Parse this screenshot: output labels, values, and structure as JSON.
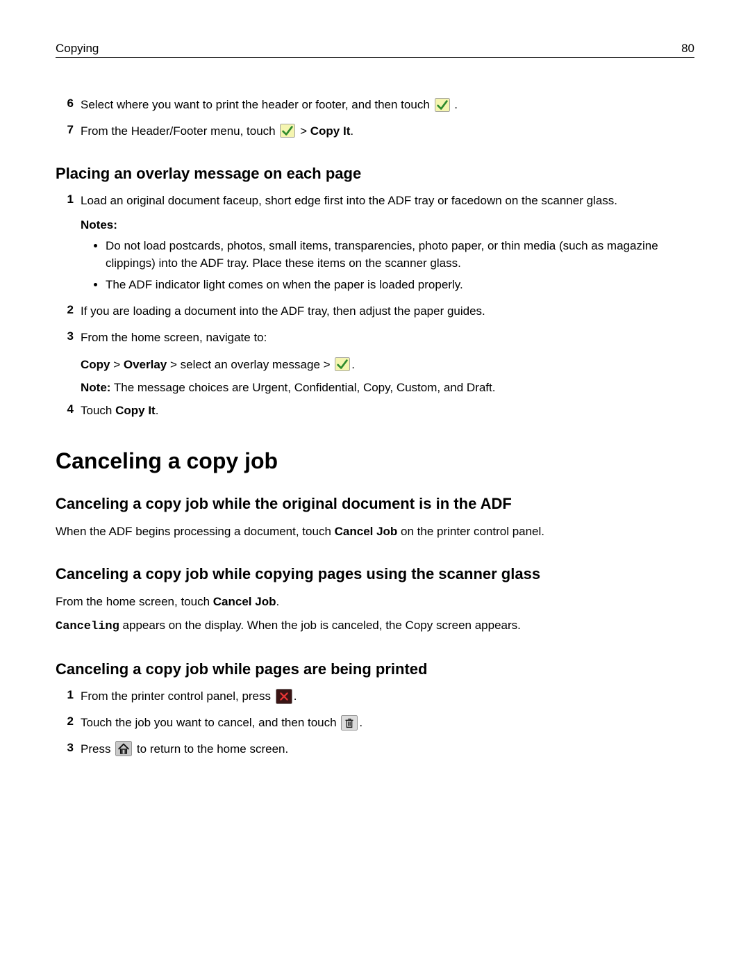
{
  "header": {
    "section": "Copying",
    "page_number": "80"
  },
  "top_steps": {
    "s6": {
      "num": "6",
      "a": "Select where you want to print the header or footer, and then touch ",
      "b": "."
    },
    "s7": {
      "num": "7",
      "a": "From the Header/Footer menu, touch ",
      "gt": " > ",
      "bold": "Copy It",
      "c": "."
    }
  },
  "overlay": {
    "heading": "Placing an overlay message on each page",
    "s1": {
      "num": "1",
      "text": "Load an original document faceup, short edge first into the ADF tray or facedown on the scanner glass."
    },
    "notes_label": "Notes:",
    "note1": "Do not load postcards, photos, small items, transparencies, photo paper, or thin media (such as magazine clippings) into the ADF tray. Place these items on the scanner glass.",
    "note2": "The ADF indicator light comes on when the paper is loaded properly.",
    "s2": {
      "num": "2",
      "text": "If you are loading a document into the ADF tray, then adjust the paper guides."
    },
    "s3": {
      "num": "3",
      "text": "From the home screen, navigate to:"
    },
    "nav": {
      "b1": "Copy",
      "gt1": " > ",
      "b2": "Overlay",
      "rest": " > select an overlay message > ",
      "dot": "."
    },
    "note_line": {
      "label": "Note:",
      "text": " The message choices are Urgent, Confidential, Copy, Custom, and Draft."
    },
    "s4": {
      "num": "4",
      "a": "Touch ",
      "b": "Copy It",
      "c": "."
    }
  },
  "cancel": {
    "heading": "Canceling a copy job",
    "adf": {
      "heading": "Canceling a copy job while the original document is in the ADF",
      "p_a": "When the ADF begins processing a document, touch ",
      "p_b": "Cancel Job",
      "p_c": " on the printer control panel."
    },
    "glass": {
      "heading": "Canceling a copy job while copying pages using the scanner glass",
      "p1_a": "From the home screen, touch ",
      "p1_b": "Cancel Job",
      "p1_c": ".",
      "p2_a": "Canceling",
      "p2_b": " appears on the display. When the job is canceled, the Copy screen appears."
    },
    "printing": {
      "heading": "Canceling a copy job while pages are being printed",
      "s1": {
        "num": "1",
        "a": "From the printer control panel, press ",
        "b": "."
      },
      "s2": {
        "num": "2",
        "a": "Touch the job you want to cancel, and then touch ",
        "b": "."
      },
      "s3": {
        "num": "3",
        "a": "Press ",
        "b": " to return to the home screen."
      }
    }
  }
}
